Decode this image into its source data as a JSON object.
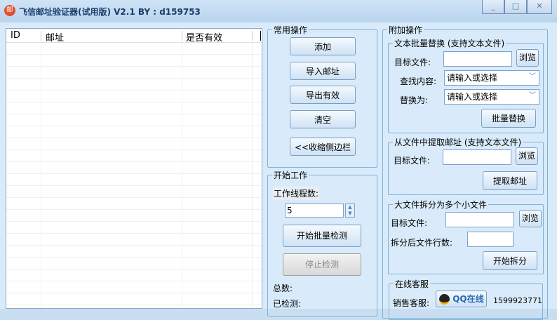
{
  "window": {
    "title": "飞信邮址验证器(试用版) V2.1  BY : d159753",
    "icon": "邮",
    "minimize": "_",
    "maximize": "□",
    "close": "✕"
  },
  "list": {
    "columns": [
      "ID",
      "邮址",
      "是否有效"
    ]
  },
  "common_ops": {
    "title": "常用操作",
    "add": "添加",
    "import": "导入邮址",
    "export": "导出有效",
    "clear": "清空",
    "collapse": "<<收缩侧边栏"
  },
  "work": {
    "title": "开始工作",
    "threads_label": "工作线程数:",
    "threads_value": "5",
    "start": "开始批量检测",
    "stop": "停止检测",
    "total_label": "总数:",
    "checked_label": "已检测:"
  },
  "extra": {
    "title": "附加操作",
    "replace": {
      "title": "文本批量替换 (支持文本文件)",
      "target_label": "目标文件:",
      "browse": "浏览",
      "find_label": "查找内容:",
      "find_placeholder": "请输入或选择",
      "replace_label": "替换为:",
      "replace_placeholder": "请输入或选择",
      "button": "批量替换"
    },
    "extract": {
      "title": "从文件中提取邮址 (支持文本文件)",
      "target_label": "目标文件:",
      "browse": "浏览",
      "button": "提取邮址"
    },
    "split": {
      "title": "大文件拆分为多个小文件",
      "target_label": "目标文件:",
      "browse": "浏览",
      "lines_label": "拆分后文件行数:",
      "button": "开始拆分"
    },
    "support": {
      "title": "在线客服",
      "sales_label": "销售客服:",
      "qq_button": "QQ在线",
      "qq_number": "1599923771"
    }
  }
}
